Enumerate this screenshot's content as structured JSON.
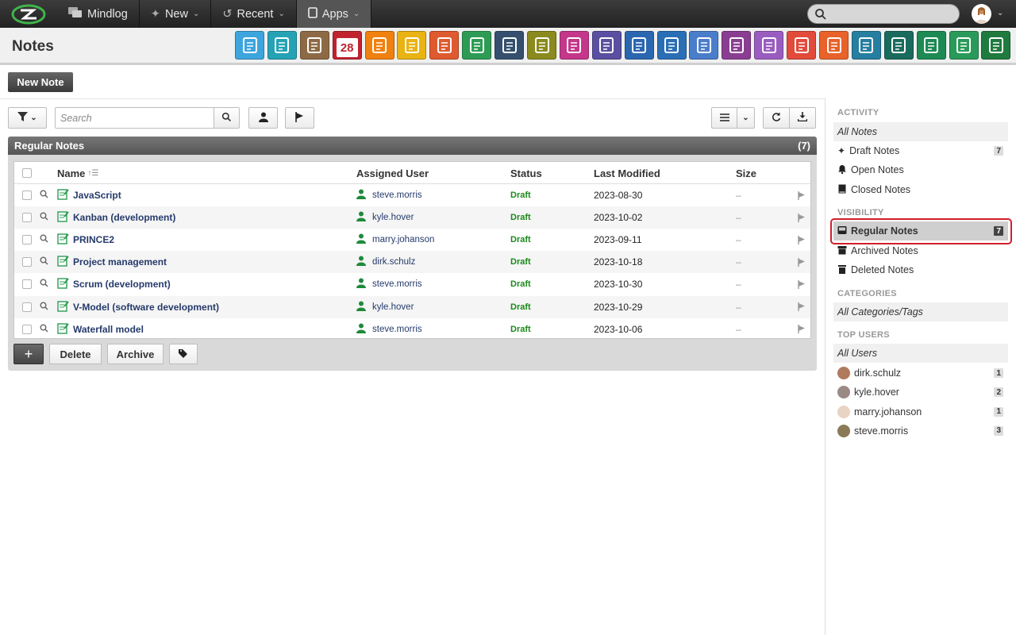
{
  "topbar": {
    "nav": [
      {
        "label": "Mindlog",
        "icon": "chat-icon",
        "dropdown": false
      },
      {
        "label": "New",
        "icon": "sparkle-icon",
        "dropdown": true
      },
      {
        "label": "Recent",
        "icon": "history-icon",
        "dropdown": true
      },
      {
        "label": "Apps",
        "icon": "tablet-icon",
        "dropdown": true,
        "active": true
      }
    ],
    "search_placeholder": ""
  },
  "header": {
    "title": "Notes",
    "apps": [
      {
        "name": "email-app-icon",
        "color": "#3da5de"
      },
      {
        "name": "address-app-icon",
        "color": "#25a3b5"
      },
      {
        "name": "contacts-app-icon",
        "color": "#8d6a45"
      },
      {
        "name": "calendar-app-icon",
        "color": "#c0232e",
        "text": "28"
      },
      {
        "name": "timer-app-icon",
        "color": "#f0810f"
      },
      {
        "name": "tasks-app-icon",
        "color": "#e9b313"
      },
      {
        "name": "projects-app-icon",
        "color": "#e05a30"
      },
      {
        "name": "notes-app-icon",
        "color": "#2e9b55"
      },
      {
        "name": "bookmarks-app-icon",
        "color": "#35506e"
      },
      {
        "name": "documents-app-icon",
        "color": "#8a8a1e"
      },
      {
        "name": "helpdesk-app-icon",
        "color": "#c4378b"
      },
      {
        "name": "finance-app-icon",
        "color": "#5a4fa0"
      },
      {
        "name": "shipping-app-icon",
        "color": "#2b67b0"
      },
      {
        "name": "support-app-icon",
        "color": "#2a6fb6"
      },
      {
        "name": "budget-app-icon",
        "color": "#4a7ecb"
      },
      {
        "name": "contracts-app-icon",
        "color": "#8a3e92"
      },
      {
        "name": "deals-app-icon",
        "color": "#9b5cc0"
      },
      {
        "name": "pdf-app-icon",
        "color": "#e24a3a"
      },
      {
        "name": "broadcast-app-icon",
        "color": "#e8622a"
      },
      {
        "name": "downloads-app-icon",
        "color": "#267ea0"
      },
      {
        "name": "purchasing-app-icon",
        "color": "#1a6b5e"
      },
      {
        "name": "payments-app-icon",
        "color": "#1d8a54"
      },
      {
        "name": "pricing-app-icon",
        "color": "#2a9a5a"
      },
      {
        "name": "database-app-icon",
        "color": "#1f7a3e"
      }
    ]
  },
  "actions": {
    "new_note": "New Note"
  },
  "toolbar": {
    "search_placeholder": "Search"
  },
  "panel": {
    "title": "Regular Notes",
    "count": "(7)",
    "columns": [
      "Name",
      "Assigned User",
      "Status",
      "Last Modified",
      "Size"
    ],
    "rows": [
      {
        "name": "JavaScript",
        "user": "steve.morris",
        "status": "Draft",
        "modified": "2023-08-30",
        "size": "–"
      },
      {
        "name": "Kanban (development)",
        "user": "kyle.hover",
        "status": "Draft",
        "modified": "2023-10-02",
        "size": "–"
      },
      {
        "name": "PRINCE2",
        "user": "marry.johanson",
        "status": "Draft",
        "modified": "2023-09-11",
        "size": "–"
      },
      {
        "name": "Project management",
        "user": "dirk.schulz",
        "status": "Draft",
        "modified": "2023-10-18",
        "size": "–"
      },
      {
        "name": "Scrum (development)",
        "user": "steve.morris",
        "status": "Draft",
        "modified": "2023-10-30",
        "size": "–"
      },
      {
        "name": "V-Model (software development)",
        "user": "kyle.hover",
        "status": "Draft",
        "modified": "2023-10-29",
        "size": "–"
      },
      {
        "name": "Waterfall model",
        "user": "steve.morris",
        "status": "Draft",
        "modified": "2023-10-06",
        "size": "–"
      }
    ],
    "footer": {
      "add": "+",
      "delete": "Delete",
      "archive": "Archive"
    }
  },
  "sidebar": {
    "activity": {
      "heading": "ACTIVITY",
      "all": "All Notes",
      "items": [
        {
          "label": "Draft Notes",
          "count": "7",
          "icon": "sparkle-icon"
        },
        {
          "label": "Open Notes",
          "count": "",
          "icon": "bell-icon"
        },
        {
          "label": "Closed Notes",
          "count": "",
          "icon": "book-icon"
        }
      ]
    },
    "visibility": {
      "heading": "VISIBILITY",
      "items": [
        {
          "label": "Regular Notes",
          "count": "7",
          "icon": "inbox-icon",
          "selected": true
        },
        {
          "label": "Archived Notes",
          "count": "",
          "icon": "archive-icon"
        },
        {
          "label": "Deleted Notes",
          "count": "",
          "icon": "trash-icon"
        }
      ]
    },
    "categories": {
      "heading": "CATEGORIES",
      "all": "All Categories/Tags"
    },
    "users": {
      "heading": "TOP USERS",
      "all": "All Users",
      "items": [
        {
          "label": "dirk.schulz",
          "count": "1",
          "color": "#b07a5c"
        },
        {
          "label": "kyle.hover",
          "count": "2",
          "color": "#9a8a84"
        },
        {
          "label": "marry.johanson",
          "count": "1",
          "color": "#e9d3c3"
        },
        {
          "label": "steve.morris",
          "count": "3",
          "color": "#8a7a55"
        }
      ]
    }
  }
}
